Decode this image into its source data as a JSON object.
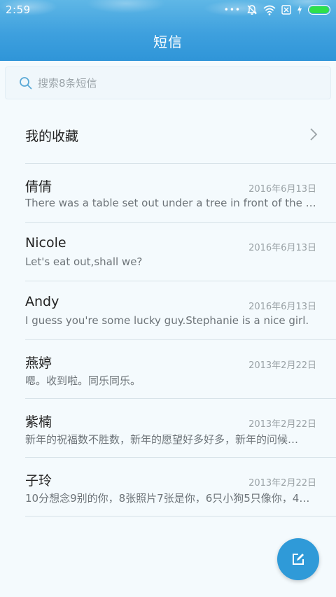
{
  "status_bar": {
    "time": "2:59",
    "icons": [
      "more-dots-icon",
      "silent-bell-icon",
      "wifi-icon",
      "sim-card-icon",
      "charging-icon",
      "battery-icon"
    ],
    "battery_level": 1.0,
    "battery_color": "#2ee04a"
  },
  "header": {
    "title": "短信",
    "color": "#3ea0de"
  },
  "search": {
    "placeholder": "搜索8条短信",
    "value": ""
  },
  "favorites": {
    "label": "我的收藏"
  },
  "messages": [
    {
      "name": "倩倩",
      "date": "2016年6月13日",
      "preview": "There was a table set out under a tree in front of the ho…"
    },
    {
      "name": "Nicole",
      "date": "2016年6月13日",
      "preview": "Let's eat out,shall we?"
    },
    {
      "name": "Andy",
      "date": "2016年6月13日",
      "preview": "I guess you're some lucky guy.Stephanie is a nice girl."
    },
    {
      "name": "燕婷",
      "date": "2013年2月22日",
      "preview": "嗯。收到啦。同乐同乐。"
    },
    {
      "name": "紫楠",
      "date": "2013年2月22日",
      "preview": "新年的祝福数不胜数，新年的愿望好多好多，新年的问候…"
    },
    {
      "name": "子玲",
      "date": "2013年2月22日",
      "preview": "10分想念9别的你，8张照片7张是你，6只小狗5只像你，4…"
    }
  ],
  "fab": {
    "icon": "compose-icon",
    "color": "#2f9ad8"
  }
}
